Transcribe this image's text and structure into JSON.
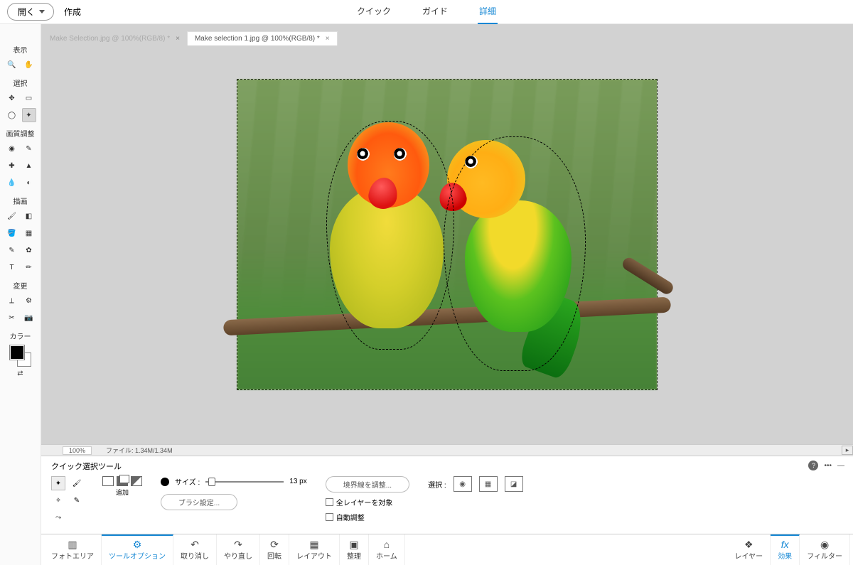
{
  "topbar": {
    "open": "開く",
    "create": "作成"
  },
  "modes": {
    "quick": "クイック",
    "guided": "ガイド",
    "detail": "詳細"
  },
  "doctabs": [
    {
      "label": "Make Selection.jpg @ 100%(RGB/8) *",
      "active": false
    },
    {
      "label": "Make selection 1.jpg @ 100%(RGB/8) *",
      "active": true
    }
  ],
  "tools": {
    "view": "表示",
    "select": "選択",
    "adjust": "画質調整",
    "draw": "描画",
    "modify": "変更",
    "color": "カラー"
  },
  "status": {
    "zoom": "100%",
    "file": "ファイル: 1.34M/1.34M"
  },
  "options": {
    "title": "クイック選択ツール",
    "add": "追加",
    "size_label": "サイズ :",
    "size_value": "13 px",
    "brush_settings": "ブラシ設定...",
    "refine": "境界線を調整...",
    "all_layers": "全レイヤーを対象",
    "auto_adjust": "自動調整",
    "selection": "選択 :"
  },
  "bottombar": {
    "photo_area": "フォトエリア",
    "tool_options": "ツールオプション",
    "undo": "取り消し",
    "redo": "やり直し",
    "rotate": "回転",
    "layout": "レイアウト",
    "organize": "整理",
    "home": "ホーム",
    "layers": "レイヤー",
    "effects": "効果",
    "filters": "フィルター"
  }
}
